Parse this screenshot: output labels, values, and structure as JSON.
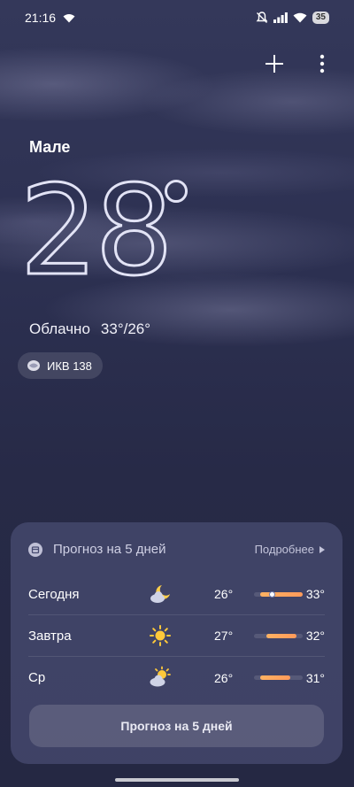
{
  "status": {
    "time": "21:16",
    "battery": "35"
  },
  "weather": {
    "city": "Мале",
    "temp": "28",
    "condition": "Облачно",
    "range": "33°/26°",
    "aqi": "ИКВ 138"
  },
  "forecast": {
    "title": "Прогноз на 5 дней",
    "more_label": "Подробнее",
    "button_label": "Прогноз на 5 дней",
    "days": [
      {
        "day": "Сегодня",
        "icon": "moon-cloud-icon",
        "min": "26°",
        "max": "33°",
        "min_val": 26,
        "max_val": 33,
        "current": 28
      },
      {
        "day": "Завтра",
        "icon": "sun-icon",
        "min": "27°",
        "max": "32°",
        "min_val": 27,
        "max_val": 32
      },
      {
        "day": "Ср",
        "icon": "sun-cloud-icon",
        "min": "26°",
        "max": "31°",
        "min_val": 26,
        "max_val": 31
      }
    ]
  },
  "colors": {
    "accent": "#ff9a5a",
    "card": "#464a70",
    "background": "#2a2d4b"
  }
}
